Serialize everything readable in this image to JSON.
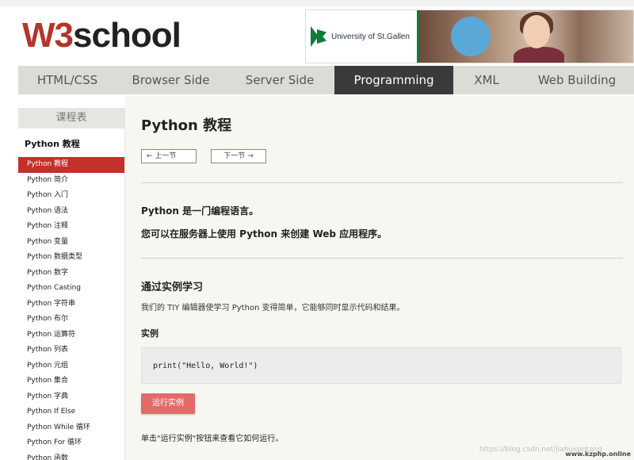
{
  "logo": {
    "w3": "W3",
    "school": "school"
  },
  "ad": {
    "university": "University of St.Gallen"
  },
  "nav": {
    "items": [
      {
        "label": "HTML/CSS",
        "width": 0
      },
      {
        "label": "Browser Side"
      },
      {
        "label": "Server Side"
      },
      {
        "label": "Programming",
        "active": true
      },
      {
        "label": "XML"
      },
      {
        "label": "Web Building"
      }
    ]
  },
  "sidebar": {
    "heading": "课程表",
    "section": "Python 教程",
    "items": [
      "Python 教程",
      "Python 简介",
      "Python 入门",
      "Python 语法",
      "Python 注释",
      "Python 变量",
      "Python 数据类型",
      "Python 数字",
      "Python Casting",
      "Python 字符串",
      "Python 布尔",
      "Python 运算符",
      "Python 列表",
      "Python 元组",
      "Python 集合",
      "Python 字典",
      "Python If Else",
      "Python While 循环",
      "Python For 循环",
      "Python 函数"
    ]
  },
  "content": {
    "title": "Python 教程",
    "prev": "← 上一节",
    "next": "下一节 →",
    "intro1": "Python 是一门编程语言。",
    "intro2": "您可以在服务器上使用 Python 来创建 Web 应用程序。",
    "learn_heading": "通过实例学习",
    "learn_text": "我们的 TIY 编辑器使学习 Python 变得简单，它能够同时显示代码和结果。",
    "example_heading": "实例",
    "code": "print(\"Hello, World!\")",
    "run_label": "运行实例",
    "run_hint": "单击\"运行实例\"按钮来查看它如何运行。"
  },
  "watermark": "https://blog.csdn.net/jiahuiqintang",
  "watermark2": "www.kzphp.online"
}
